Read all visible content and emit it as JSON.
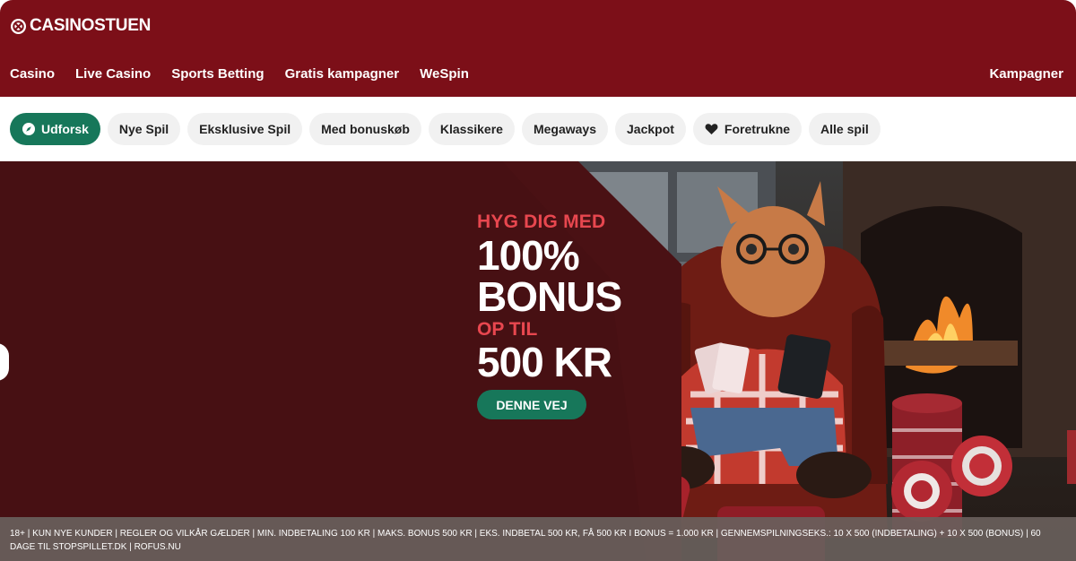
{
  "brand": {
    "name": "CASINOSTUEN"
  },
  "main_nav": [
    {
      "label": "Casino"
    },
    {
      "label": "Live Casino"
    },
    {
      "label": "Sports Betting"
    },
    {
      "label": "Gratis kampagner"
    },
    {
      "label": "WeSpin"
    }
  ],
  "header_right": {
    "label": "Kampagner"
  },
  "categories": [
    {
      "label": "Udforsk",
      "icon": "compass-icon",
      "active": true
    },
    {
      "label": "Nye Spil"
    },
    {
      "label": "Eksklusive Spil"
    },
    {
      "label": "Med bonuskøb"
    },
    {
      "label": "Klassikere"
    },
    {
      "label": "Megaways"
    },
    {
      "label": "Jackpot"
    },
    {
      "label": "Foretrukne",
      "icon": "heart-icon"
    },
    {
      "label": "Alle spil"
    }
  ],
  "hero": {
    "line1": "HYG DIG MED",
    "line2": "100%",
    "line3": "BONUS",
    "line4": "OP TIL",
    "line5": "500 KR",
    "cta": "DENNE VEJ"
  },
  "terms": "18+ | KUN NYE KUNDER | REGLER OG VILKÅR GÆLDER | MIN. INDBETALING 100 KR | MAKS. BONUS 500 KR | EKS. INDBETAL 500 KR, FÅ 500 KR I BONUS = 1.000 KR | GENNEMSPILNINGSEKS.: 10 X 500 (INDBETALING) + 10 X 500 (BONUS) | 60 DAGE TIL STOPSPILLET.DK | ROFUS.NU",
  "colors": {
    "brand_red": "#7c0f18",
    "accent_green": "#17775a",
    "promo_red": "#e8474f",
    "pill_bg": "#f1f1f1"
  }
}
